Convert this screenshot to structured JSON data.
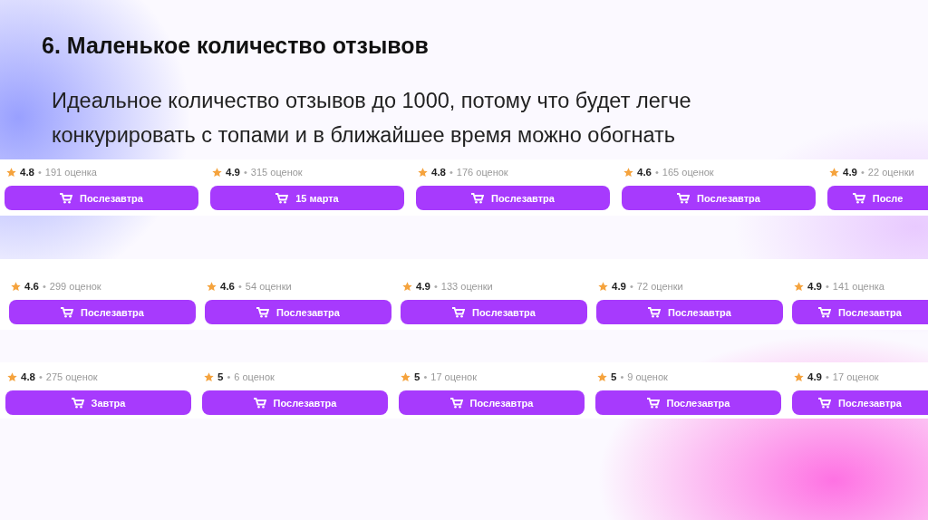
{
  "slide": {
    "title": "6. Маленькое количество отзывов",
    "text": "Идеальное количество отзывов до 1000, потому что будет легче конкурировать с топами и в ближайшее время можно обогнать"
  },
  "rows": [
    {
      "cards": [
        {
          "rating": "4.8",
          "separator": "•",
          "reviews": "191 оценка",
          "button": "Послезавтра"
        },
        {
          "rating": "4.9",
          "separator": "•",
          "reviews": "315 оценок",
          "button": "15 марта"
        },
        {
          "rating": "4.8",
          "separator": "•",
          "reviews": "176 оценок",
          "button": "Послезавтра"
        },
        {
          "rating": "4.6",
          "separator": "•",
          "reviews": "165 оценок",
          "button": "Послезавтра"
        },
        {
          "rating": "4.9",
          "separator": "•",
          "reviews": "22 оценки",
          "button": "После"
        }
      ]
    },
    {
      "cards": [
        {
          "rating": "4.6",
          "separator": "•",
          "reviews": "299 оценок",
          "button": "Послезавтра"
        },
        {
          "rating": "4.6",
          "separator": "•",
          "reviews": "54 оценки",
          "button": "Послезавтра"
        },
        {
          "rating": "4.9",
          "separator": "•",
          "reviews": "133 оценки",
          "button": "Послезавтра"
        },
        {
          "rating": "4.9",
          "separator": "•",
          "reviews": "72 оценки",
          "button": "Послезавтра"
        },
        {
          "rating": "4.9",
          "separator": "•",
          "reviews": "141 оценка",
          "button": "Послезавтра"
        }
      ]
    },
    {
      "cards": [
        {
          "rating": "4.8",
          "separator": "•",
          "reviews": "275 оценок",
          "button": "Завтра"
        },
        {
          "rating": "5",
          "separator": "•",
          "reviews": "6 оценок",
          "button": "Послезавтра"
        },
        {
          "rating": "5",
          "separator": "•",
          "reviews": "17 оценок",
          "button": "Послезавтра"
        },
        {
          "rating": "5",
          "separator": "•",
          "reviews": "9 оценок",
          "button": "Послезавтра"
        },
        {
          "rating": "4.9",
          "separator": "•",
          "reviews": "17 оценок",
          "button": "Послезавтра"
        }
      ]
    }
  ]
}
